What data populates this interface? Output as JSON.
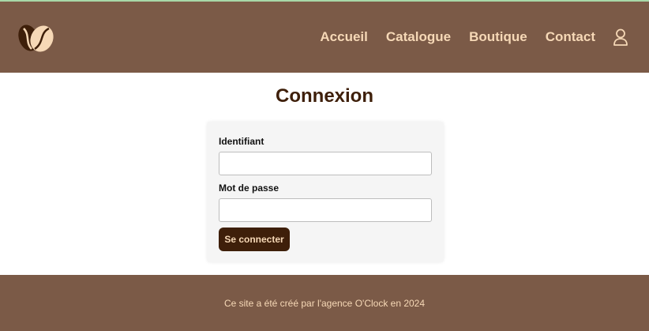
{
  "colors": {
    "header_bg": "#7b5a47",
    "nav_text": "#f6d8b6",
    "title_text": "#3e1f0a",
    "button_bg": "#3e1f0a",
    "card_bg": "#f5f5f5",
    "top_line": "#a8d8a8"
  },
  "header": {
    "logo_icon": "coffee-beans-logo-icon",
    "nav": [
      {
        "label": "Accueil"
      },
      {
        "label": "Catalogue"
      },
      {
        "label": "Boutique"
      },
      {
        "label": "Contact"
      }
    ],
    "user_icon": "user-icon"
  },
  "main": {
    "title": "Connexion",
    "form": {
      "identifiant_label": "Identifiant",
      "identifiant_value": "",
      "password_label": "Mot de passe",
      "password_value": "",
      "submit_label": "Se connecter"
    }
  },
  "footer": {
    "text": "Ce site a été créé par l'agence O'Clock en 2024"
  }
}
